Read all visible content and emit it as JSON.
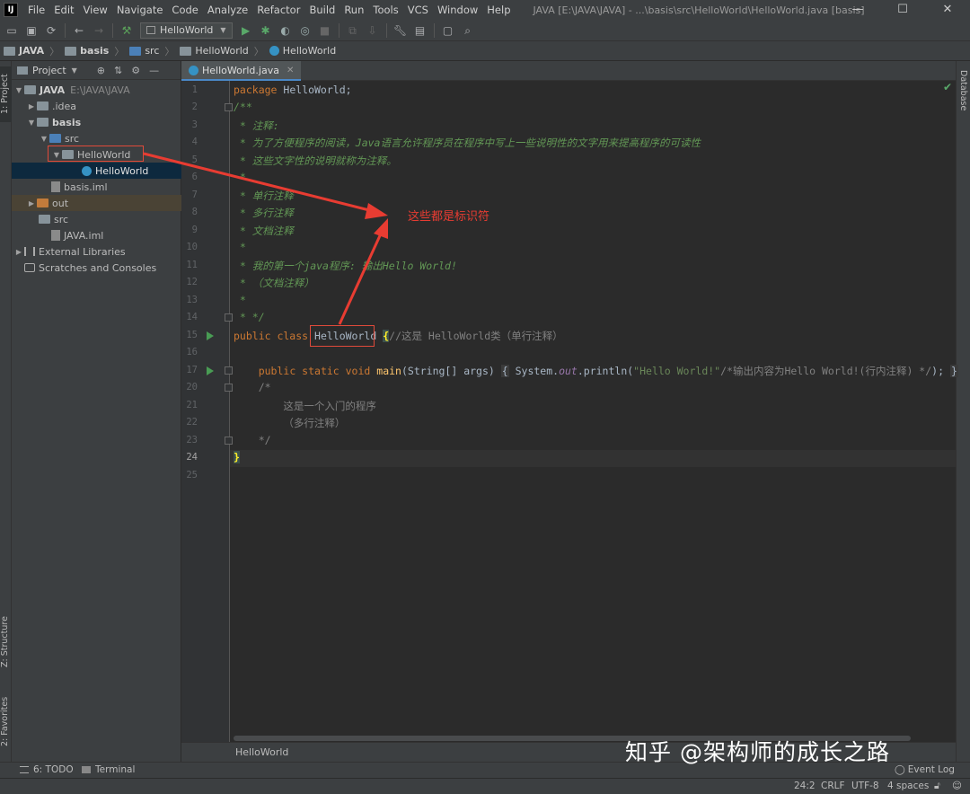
{
  "titlebar": {
    "menus": [
      "File",
      "Edit",
      "View",
      "Navigate",
      "Code",
      "Analyze",
      "Refactor",
      "Build",
      "Run",
      "Tools",
      "VCS",
      "Window",
      "Help"
    ],
    "window_title": "JAVA [E:\\JAVA\\JAVA] - ...\\basis\\src\\HelloWorld\\HelloWorld.java [basis]",
    "minimize": "—",
    "maximize": "☐",
    "close": "✕"
  },
  "toolbar": {
    "run_config": "HelloWorld"
  },
  "breadcrumb": {
    "items": [
      "JAVA",
      "basis",
      "src",
      "HelloWorld",
      "HelloWorld"
    ]
  },
  "left_stripe": {
    "project_tab": "1: Project",
    "structure_tab": "Z: Structure",
    "favorites_tab": "2: Favorites"
  },
  "project_panel": {
    "title": "Project",
    "tree": [
      {
        "label": "JAVA",
        "hint": "E:\\JAVA\\JAVA"
      },
      {
        "label": ".idea"
      },
      {
        "label": "basis"
      },
      {
        "label": "src"
      },
      {
        "label": "HelloWorld"
      },
      {
        "label": "HelloWorld"
      },
      {
        "label": "basis.iml"
      },
      {
        "label": "out"
      },
      {
        "label": "src"
      },
      {
        "label": "JAVA.iml"
      },
      {
        "label": "External Libraries"
      },
      {
        "label": "Scratches and Consoles"
      }
    ]
  },
  "editor": {
    "tab_label": "HelloWorld.java",
    "line_numbers": [
      "1",
      "2",
      "3",
      "4",
      "5",
      "6",
      "7",
      "8",
      "9",
      "10",
      "11",
      "12",
      "13",
      "14",
      "15",
      "16",
      "17",
      "20",
      "21",
      "22",
      "23",
      "24",
      "25"
    ],
    "current_line": "24",
    "lines": {
      "l1_kw": "package",
      "l1_rest": " HelloWorld;",
      "l2": "/**",
      "l3": " * 注释:",
      "l4": " * 为了方便程序的阅读，Java语言允许程序员在程序中写上一些说明性的文字用来提高程序的可读性",
      "l5": " * 这些文字性的说明就称为注释。",
      "l6": " *",
      "l7": " * 单行注释",
      "l8": " * 多行注释",
      "l9": " * 文档注释",
      "l10": " *",
      "l11": " * 我的第一个java程序: 输出Hello World!",
      "l12": " * （文档注释）",
      "l13": " *",
      "l14": " * */",
      "l15_kw": "public class ",
      "l15_name": "HelloWorld",
      "l15_brace": "{",
      "l15_comment": "//这是 HelloWorld类（单行注释）",
      "l17_kw": "public static void ",
      "l17_fn": "main",
      "l17_params": "(String[] args) ",
      "l17_brace_open": "{",
      "l17_sys": " System.",
      "l17_out": "out",
      "l17_print": ".println(",
      "l17_str": "\"Hello World!\"",
      "l17_comment": "/*输出内容为Hello World!(行内注释) */",
      "l17_end": ");",
      "l17_brace_close": "}",
      "l20": "/*",
      "l21": "这是一个入门的程序",
      "l22": "（多行注释）",
      "l23": "*/",
      "l24": "}"
    },
    "annotation": "这些都是标识符",
    "footer_breadcrumb": "HelloWorld"
  },
  "right_stripe": {
    "database_tab": "Database"
  },
  "tool_windows": {
    "todo": "6: TODO",
    "terminal": "Terminal",
    "event_log": "Event Log"
  },
  "statusbar": {
    "position": "24:2",
    "line_sep": "CRLF",
    "encoding": "UTF-8",
    "indent": "4 spaces"
  },
  "watermark": "知乎 @架构师的成长之路",
  "colors": {
    "annotation_red": "#e83c32",
    "keyword": "#cc7832",
    "doc_comment": "#629755",
    "string": "#6a8759",
    "function": "#ffc66d"
  }
}
